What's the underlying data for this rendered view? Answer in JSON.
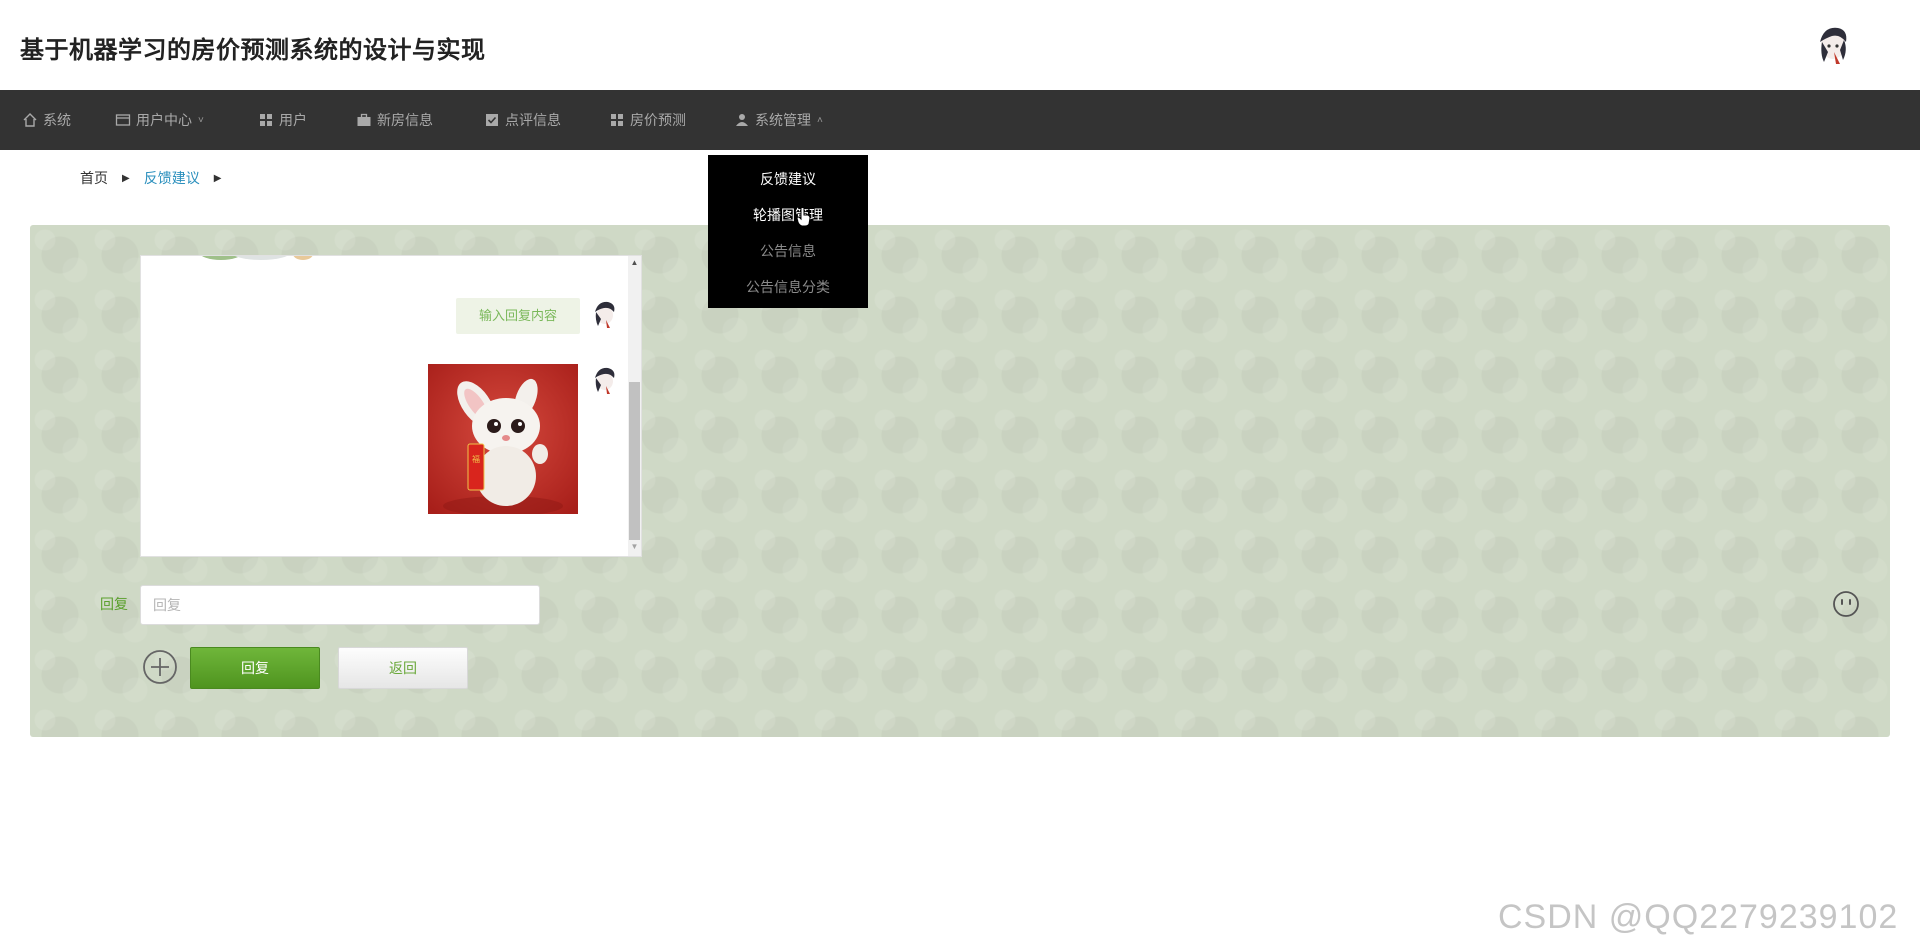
{
  "header": {
    "title": "基于机器学习的房价预测系统的设计与实现",
    "avatar": "avatar-icon"
  },
  "nav": {
    "items": [
      {
        "label": "系统",
        "icon": "home-icon"
      },
      {
        "label": "用户中心",
        "icon": "window-icon",
        "chevron": "˅"
      },
      {
        "label": "用户",
        "icon": "grid-icon"
      },
      {
        "label": "新房信息",
        "icon": "briefcase-icon"
      },
      {
        "label": "点评信息",
        "icon": "check-square-icon"
      },
      {
        "label": "房价预测",
        "icon": "grid-icon"
      },
      {
        "label": "系统管理",
        "icon": "user-icon",
        "chevron": "˄"
      }
    ]
  },
  "dropdown": {
    "items": [
      {
        "label": "反馈建议"
      },
      {
        "label": "轮播图管理"
      },
      {
        "label": "公告信息"
      },
      {
        "label": "公告信息分类"
      }
    ]
  },
  "breadcrumb": {
    "home": "首页",
    "current": "反馈建议"
  },
  "chat": {
    "message_text": "输入回复内容",
    "image_caption": "rabbit-image"
  },
  "reply": {
    "label": "回复",
    "placeholder": "回复",
    "value": ""
  },
  "buttons": {
    "reply": "回复",
    "back": "返回"
  },
  "watermark": "CSDN @QQ2279239102",
  "colors": {
    "nav_bg": "#333333",
    "panel_bg": "#cfd9c6",
    "accent_green": "#5aa02c",
    "link_blue": "#2a8fbd",
    "dropdown_bg": "#000000"
  }
}
